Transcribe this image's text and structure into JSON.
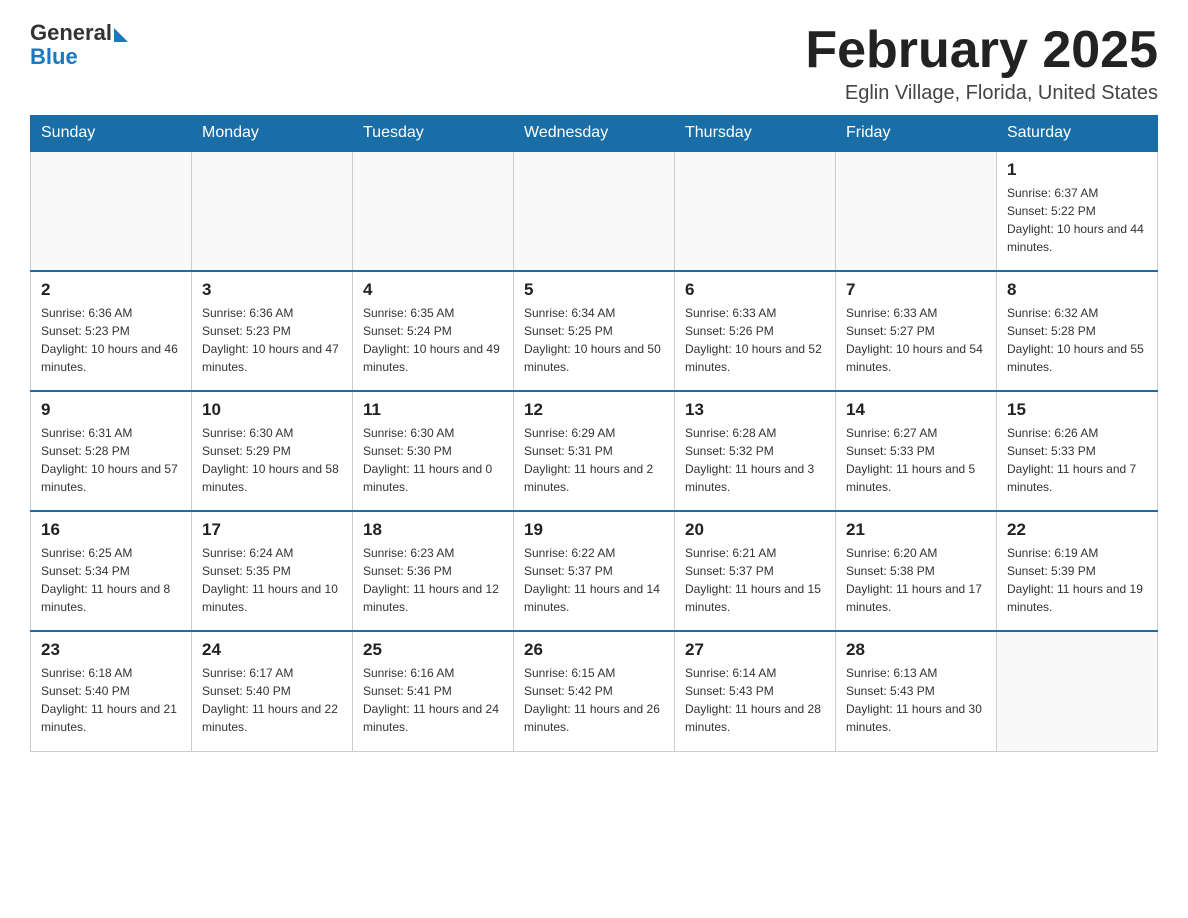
{
  "header": {
    "logo_general": "General",
    "logo_blue": "Blue",
    "month_title": "February 2025",
    "subtitle": "Eglin Village, Florida, United States"
  },
  "weekdays": [
    "Sunday",
    "Monday",
    "Tuesday",
    "Wednesday",
    "Thursday",
    "Friday",
    "Saturday"
  ],
  "weeks": [
    [
      {
        "day": "",
        "sunrise": "",
        "sunset": "",
        "daylight": ""
      },
      {
        "day": "",
        "sunrise": "",
        "sunset": "",
        "daylight": ""
      },
      {
        "day": "",
        "sunrise": "",
        "sunset": "",
        "daylight": ""
      },
      {
        "day": "",
        "sunrise": "",
        "sunset": "",
        "daylight": ""
      },
      {
        "day": "",
        "sunrise": "",
        "sunset": "",
        "daylight": ""
      },
      {
        "day": "",
        "sunrise": "",
        "sunset": "",
        "daylight": ""
      },
      {
        "day": "1",
        "sunrise": "Sunrise: 6:37 AM",
        "sunset": "Sunset: 5:22 PM",
        "daylight": "Daylight: 10 hours and 44 minutes."
      }
    ],
    [
      {
        "day": "2",
        "sunrise": "Sunrise: 6:36 AM",
        "sunset": "Sunset: 5:23 PM",
        "daylight": "Daylight: 10 hours and 46 minutes."
      },
      {
        "day": "3",
        "sunrise": "Sunrise: 6:36 AM",
        "sunset": "Sunset: 5:23 PM",
        "daylight": "Daylight: 10 hours and 47 minutes."
      },
      {
        "day": "4",
        "sunrise": "Sunrise: 6:35 AM",
        "sunset": "Sunset: 5:24 PM",
        "daylight": "Daylight: 10 hours and 49 minutes."
      },
      {
        "day": "5",
        "sunrise": "Sunrise: 6:34 AM",
        "sunset": "Sunset: 5:25 PM",
        "daylight": "Daylight: 10 hours and 50 minutes."
      },
      {
        "day": "6",
        "sunrise": "Sunrise: 6:33 AM",
        "sunset": "Sunset: 5:26 PM",
        "daylight": "Daylight: 10 hours and 52 minutes."
      },
      {
        "day": "7",
        "sunrise": "Sunrise: 6:33 AM",
        "sunset": "Sunset: 5:27 PM",
        "daylight": "Daylight: 10 hours and 54 minutes."
      },
      {
        "day": "8",
        "sunrise": "Sunrise: 6:32 AM",
        "sunset": "Sunset: 5:28 PM",
        "daylight": "Daylight: 10 hours and 55 minutes."
      }
    ],
    [
      {
        "day": "9",
        "sunrise": "Sunrise: 6:31 AM",
        "sunset": "Sunset: 5:28 PM",
        "daylight": "Daylight: 10 hours and 57 minutes."
      },
      {
        "day": "10",
        "sunrise": "Sunrise: 6:30 AM",
        "sunset": "Sunset: 5:29 PM",
        "daylight": "Daylight: 10 hours and 58 minutes."
      },
      {
        "day": "11",
        "sunrise": "Sunrise: 6:30 AM",
        "sunset": "Sunset: 5:30 PM",
        "daylight": "Daylight: 11 hours and 0 minutes."
      },
      {
        "day": "12",
        "sunrise": "Sunrise: 6:29 AM",
        "sunset": "Sunset: 5:31 PM",
        "daylight": "Daylight: 11 hours and 2 minutes."
      },
      {
        "day": "13",
        "sunrise": "Sunrise: 6:28 AM",
        "sunset": "Sunset: 5:32 PM",
        "daylight": "Daylight: 11 hours and 3 minutes."
      },
      {
        "day": "14",
        "sunrise": "Sunrise: 6:27 AM",
        "sunset": "Sunset: 5:33 PM",
        "daylight": "Daylight: 11 hours and 5 minutes."
      },
      {
        "day": "15",
        "sunrise": "Sunrise: 6:26 AM",
        "sunset": "Sunset: 5:33 PM",
        "daylight": "Daylight: 11 hours and 7 minutes."
      }
    ],
    [
      {
        "day": "16",
        "sunrise": "Sunrise: 6:25 AM",
        "sunset": "Sunset: 5:34 PM",
        "daylight": "Daylight: 11 hours and 8 minutes."
      },
      {
        "day": "17",
        "sunrise": "Sunrise: 6:24 AM",
        "sunset": "Sunset: 5:35 PM",
        "daylight": "Daylight: 11 hours and 10 minutes."
      },
      {
        "day": "18",
        "sunrise": "Sunrise: 6:23 AM",
        "sunset": "Sunset: 5:36 PM",
        "daylight": "Daylight: 11 hours and 12 minutes."
      },
      {
        "day": "19",
        "sunrise": "Sunrise: 6:22 AM",
        "sunset": "Sunset: 5:37 PM",
        "daylight": "Daylight: 11 hours and 14 minutes."
      },
      {
        "day": "20",
        "sunrise": "Sunrise: 6:21 AM",
        "sunset": "Sunset: 5:37 PM",
        "daylight": "Daylight: 11 hours and 15 minutes."
      },
      {
        "day": "21",
        "sunrise": "Sunrise: 6:20 AM",
        "sunset": "Sunset: 5:38 PM",
        "daylight": "Daylight: 11 hours and 17 minutes."
      },
      {
        "day": "22",
        "sunrise": "Sunrise: 6:19 AM",
        "sunset": "Sunset: 5:39 PM",
        "daylight": "Daylight: 11 hours and 19 minutes."
      }
    ],
    [
      {
        "day": "23",
        "sunrise": "Sunrise: 6:18 AM",
        "sunset": "Sunset: 5:40 PM",
        "daylight": "Daylight: 11 hours and 21 minutes."
      },
      {
        "day": "24",
        "sunrise": "Sunrise: 6:17 AM",
        "sunset": "Sunset: 5:40 PM",
        "daylight": "Daylight: 11 hours and 22 minutes."
      },
      {
        "day": "25",
        "sunrise": "Sunrise: 6:16 AM",
        "sunset": "Sunset: 5:41 PM",
        "daylight": "Daylight: 11 hours and 24 minutes."
      },
      {
        "day": "26",
        "sunrise": "Sunrise: 6:15 AM",
        "sunset": "Sunset: 5:42 PM",
        "daylight": "Daylight: 11 hours and 26 minutes."
      },
      {
        "day": "27",
        "sunrise": "Sunrise: 6:14 AM",
        "sunset": "Sunset: 5:43 PM",
        "daylight": "Daylight: 11 hours and 28 minutes."
      },
      {
        "day": "28",
        "sunrise": "Sunrise: 6:13 AM",
        "sunset": "Sunset: 5:43 PM",
        "daylight": "Daylight: 11 hours and 30 minutes."
      },
      {
        "day": "",
        "sunrise": "",
        "sunset": "",
        "daylight": ""
      }
    ]
  ]
}
